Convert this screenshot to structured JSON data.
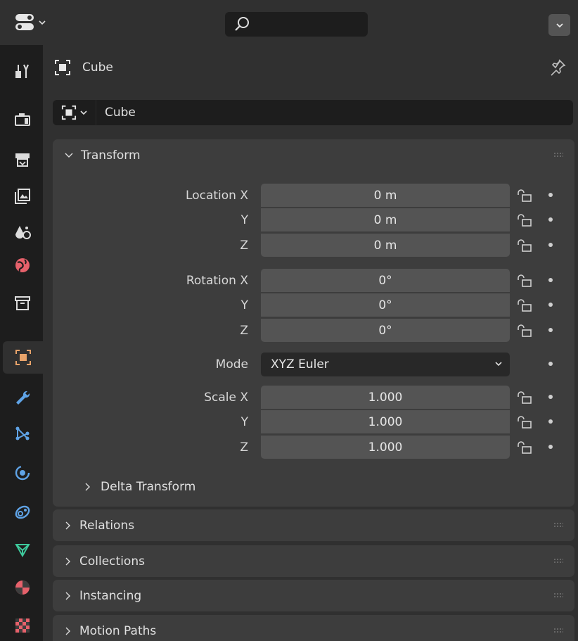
{
  "header": {
    "search_placeholder": ""
  },
  "context": {
    "object_label": "Cube"
  },
  "name_field": {
    "value": "Cube"
  },
  "transform": {
    "title": "Transform",
    "location": {
      "label": "Location X",
      "x": "0 m",
      "y": "0 m",
      "z": "0 m"
    },
    "rotation": {
      "label": "Rotation X",
      "x": "0°",
      "y": "0°",
      "z": "0°"
    },
    "mode": {
      "label": "Mode",
      "value": "XYZ Euler"
    },
    "scale": {
      "label": "Scale X",
      "x": "1.000",
      "y": "1.000",
      "z": "1.000"
    },
    "axis_y": "Y",
    "axis_z": "Z",
    "delta": "Delta Transform"
  },
  "panels": [
    "Relations",
    "Collections",
    "Instancing",
    "Motion Paths"
  ],
  "tabs": [
    "tool",
    "render",
    "output",
    "view-layer",
    "scene",
    "world",
    "collection",
    "object",
    "modifiers",
    "particles",
    "physics",
    "constraints",
    "data",
    "material",
    "texture"
  ],
  "colors": {
    "accent": "#e8a36a",
    "panel": "#3d3d3d",
    "field": "#545454",
    "background": "#303030"
  }
}
